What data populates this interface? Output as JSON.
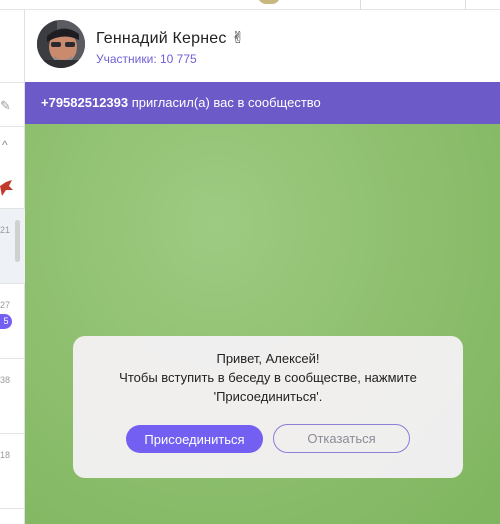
{
  "chat": {
    "title": "Геннадий Кернес",
    "title_emoji": "✌",
    "subtitle": "Участники: 10 775"
  },
  "invite": {
    "phone": "+79582512393",
    "text": " пригласил(а) вас в сообщество"
  },
  "dialog": {
    "line1": "Привет, Алексей!",
    "line2": "Чтобы вступить в беседу в сообществе, нажмите",
    "line3": "'Присоединиться'.",
    "join_label": "Присоединиться",
    "decline_label": "Отказаться"
  },
  "sidebar": {
    "items": [
      {
        "time": "21"
      },
      {
        "time": "27",
        "badge": "5"
      },
      {
        "time": "38"
      },
      {
        "time": "18"
      }
    ]
  },
  "colors": {
    "accent": "#7360f2",
    "invite_bar": "#6c5ac8",
    "chat_background": "#8fc070"
  }
}
